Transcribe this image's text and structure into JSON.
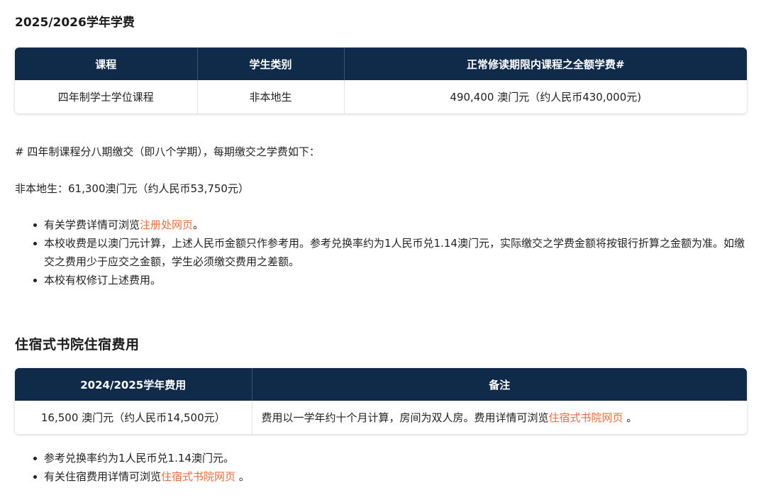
{
  "tuition": {
    "heading": "2025/2026学年学费",
    "headers": [
      "课程",
      "学生类别",
      "正常修读期限内课程之全额学费#"
    ],
    "row": [
      "四年制学士学位课程",
      "非本地生",
      "490,400 澳门元（约人民币430,000元)"
    ],
    "note_installments": "# 四年制课程分八期缴交（即八个学期），每期缴交之学费如下：",
    "note_nonlocal": "非本地生：61,300澳门元（约人民币53,750元）",
    "bullets": [
      {
        "prefix": "有关学费详情可浏览",
        "link": "注册处网页",
        "suffix": "。"
      },
      {
        "text": "本校收费是以澳门元计算，上述人民币金额只作参考用。参考兑换率约为1人民币兑1.14澳门元，实际缴交之学费金额将按银行折算之金额为准。如缴交之费用少于应交之金额，学生必须缴交费用之差额。"
      },
      {
        "text": "本校有权修订上述费用。"
      }
    ]
  },
  "housing": {
    "heading": "住宿式书院住宿费用",
    "headers": [
      "2024/2025学年费用",
      "备注"
    ],
    "row_fee": "16,500 澳门元（约人民币14,500元）",
    "row_note_prefix": "费用以一学年约十个月计算，房间为双人房。费用详情可浏览",
    "row_note_link": "住宿式书院网页",
    "row_note_suffix": " 。",
    "bullets": [
      {
        "text": "参考兑换率约为1人民币兑1.14澳门元。"
      },
      {
        "prefix": "有关住宿费用详情可浏览",
        "link": "住宿式书院网页",
        "suffix": " 。"
      }
    ]
  },
  "colors": {
    "header_bg": "#102a4a",
    "link": "#e76f3c",
    "text": "#222222"
  }
}
